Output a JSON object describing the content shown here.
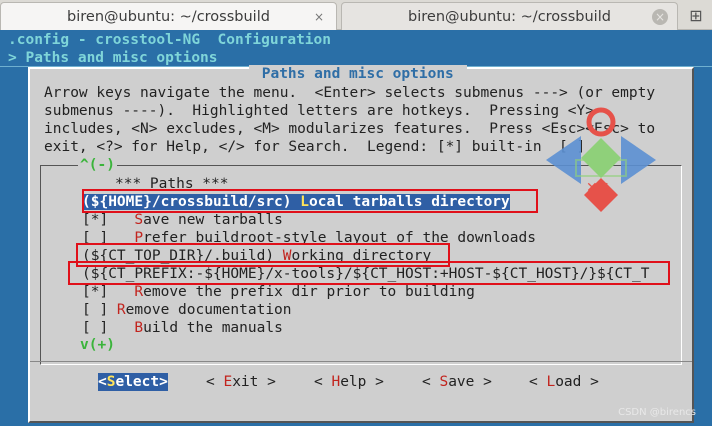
{
  "tabs": [
    {
      "title": "biren@ubuntu: ~/crossbuild",
      "close": "×"
    },
    {
      "title": "biren@ubuntu: ~/crossbuild",
      "close": "×"
    }
  ],
  "new_tab_icon": "⊞",
  "header": {
    "line1": ".config - crosstool-NG  Configuration",
    "line2": "> Paths and misc options"
  },
  "dialog": {
    "title": " Paths and misc options ",
    "help": [
      "Arrow keys navigate the menu.  <Enter> selects submenus ---> (or empty",
      "submenus ----).  Highlighted letters are hotkeys.  Pressing <Y>",
      "includes, <N> excludes, <M> modularizes features.  Press <Esc><Esc> to",
      "exit, <?> for Help, </> for Search.  Legend: [*] built-in  [ ]"
    ],
    "scroll_up": "^(-)",
    "scroll_down": "v(+)"
  },
  "menu": {
    "heading": "*** Paths ***",
    "items": [
      {
        "pre": "(${HOME}/crossbuild/src) ",
        "hk": "L",
        "post": "ocal tarballs directory",
        "selected": true
      },
      {
        "pre": "[*]   ",
        "hk": "S",
        "post": "ave new tarballs",
        "selected": false
      },
      {
        "pre": "[ ]   ",
        "hk": "P",
        "post": "refer buildroot-style layout of the downloads",
        "selected": false
      },
      {
        "pre": "(${CT_TOP_DIR}/.build) ",
        "hk": "W",
        "post": "orking directory",
        "selected": false
      },
      {
        "pre": "(${CT_PREFIX:-${HOME}/x-tools}/${CT_HOST:+HOST-${CT_HOST}/}${CT_T",
        "hk": "",
        "post": "",
        "selected": false
      },
      {
        "pre": "[*]   ",
        "hk": "R",
        "post": "emove the prefix dir prior to building",
        "selected": false
      },
      {
        "pre": "[ ] ",
        "hk": "R",
        "post": "emove documentation",
        "selected": false
      },
      {
        "pre": "[ ]   ",
        "hk": "B",
        "post": "uild the manuals",
        "selected": false
      }
    ]
  },
  "buttons": [
    {
      "pre": "<",
      "hk": "S",
      "post": "elect>",
      "active": true
    },
    {
      "pre": "< ",
      "hk": "E",
      "post": "xit >",
      "active": false
    },
    {
      "pre": "< ",
      "hk": "H",
      "post": "elp >",
      "active": false
    },
    {
      "pre": "< ",
      "hk": "S",
      "post": "ave >",
      "active": false
    },
    {
      "pre": "< ",
      "hk": "L",
      "post": "oad >",
      "active": false
    }
  ],
  "watermark": "CSDN @birencs",
  "colors": {
    "terminal_bg": "#2a6fa7",
    "dialog_bg": "#cfcfcf",
    "selection": "#2f5fa5",
    "hotkey": "#c2241e",
    "annotation_box": "#e0101a"
  }
}
